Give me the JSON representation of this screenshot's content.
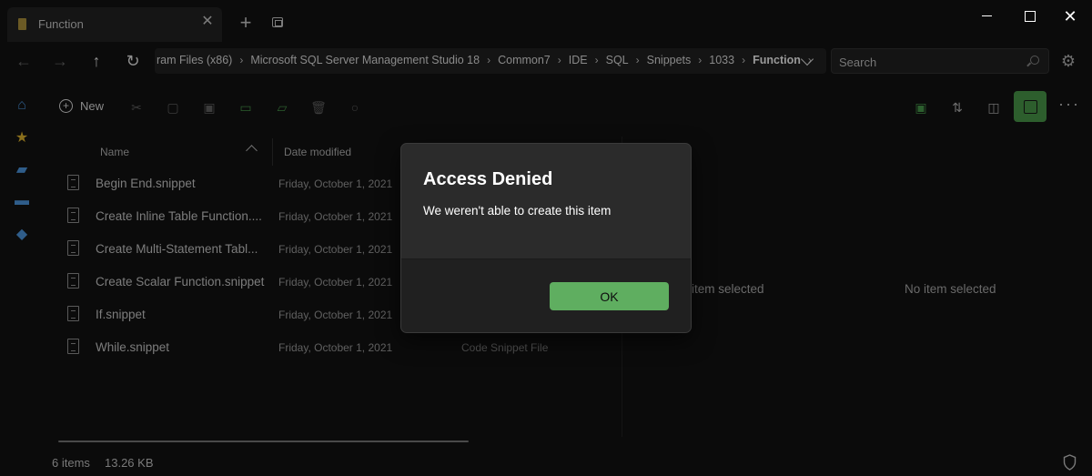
{
  "window": {
    "tab_title": "Function",
    "tab_close": "✕",
    "new_tab": "+",
    "close": "✕"
  },
  "nav": {
    "back": "←",
    "forward": "→",
    "up": "↑",
    "refresh": "↻",
    "breadcrumbs": [
      "ram Files (x86)",
      "Microsoft SQL Server Management Studio 18",
      "Common7",
      "IDE",
      "SQL",
      "Snippets",
      "1033",
      "Function"
    ],
    "separator": "›"
  },
  "search": {
    "placeholder": "Search"
  },
  "settings_icon": "⚙",
  "sidebar": {
    "home": "⌂",
    "favorites": "★",
    "drive1": "▰",
    "drive2": "▬",
    "network": "◆"
  },
  "toolbar": {
    "new_label": "New",
    "new_plus": "+",
    "cut": "✂",
    "copy": "▢",
    "paste": "▣",
    "rename": "▭",
    "share": "▱",
    "delete": "🗑",
    "properties": "○",
    "select": "▣",
    "sort": "⇅",
    "layout": "◫",
    "more": "···"
  },
  "columns": {
    "name": "Name",
    "date_modified": "Date modified"
  },
  "files": [
    {
      "name": "Begin End.snippet",
      "date": "Friday, October 1, 2021",
      "type": ""
    },
    {
      "name": "Create Inline Table Function....",
      "date": "Friday, October 1, 2021",
      "type": ""
    },
    {
      "name": "Create Multi-Statement Tabl...",
      "date": "Friday, October 1, 2021",
      "type": ""
    },
    {
      "name": "Create Scalar Function.snippet",
      "date": "Friday, October 1, 2021",
      "type": ""
    },
    {
      "name": "If.snippet",
      "date": "Friday, October 1, 2021",
      "type": ""
    },
    {
      "name": "While.snippet",
      "date": "Friday, October 1, 2021",
      "type": "Code Snippet File"
    }
  ],
  "preview": {
    "left_text": "item selected",
    "right_text": "No item selected"
  },
  "status": {
    "count": "6 items",
    "size": "13.26 KB"
  },
  "dialog": {
    "title": "Access Denied",
    "message": "We weren't able to create this item",
    "ok_label": "OK"
  }
}
